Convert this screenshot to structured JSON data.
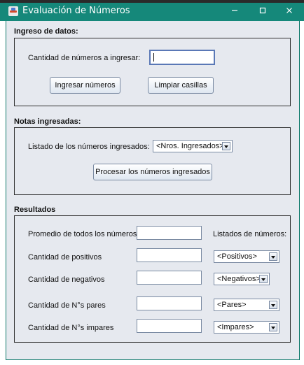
{
  "window": {
    "title": "Evaluación de Números",
    "controls": {
      "minimize": "—",
      "maximize": "☐",
      "close": "✕"
    }
  },
  "ingreso": {
    "title": "Ingreso de datos:",
    "cantidad_label": "Cantidad de números a ingresar:",
    "cantidad_value": "",
    "btn_ingresar": "Ingresar números",
    "btn_limpiar": "Limpiar casillas"
  },
  "notas": {
    "title": "Notas ingresadas:",
    "listado_label": "Listado de los números ingresados:",
    "listado_selected": "<Nros. Ingresados>",
    "btn_procesar": "Procesar los números ingresados"
  },
  "resultados": {
    "title": "Resultados",
    "listados_header": "Listados de números:",
    "rows": [
      {
        "label": "Promedio de todos los números",
        "value": "",
        "combo": null
      },
      {
        "label": "Cantidad de positivos",
        "value": "",
        "combo": "<Positivos>"
      },
      {
        "label": "Cantidad de negativos",
        "value": "",
        "combo": "<Negativos>"
      },
      {
        "label": "Cantidad de N°s pares",
        "value": "",
        "combo": "<Pares>"
      },
      {
        "label": "Cantidad de N°s impares",
        "value": "",
        "combo": "<Impares>"
      }
    ]
  },
  "icons": {
    "app": "java-app-icon",
    "minimize": "minimize-icon",
    "maximize": "maximize-icon",
    "close": "close-icon",
    "combo_arrow": "chevron-down-icon"
  },
  "colors": {
    "titlebar": "#15887a",
    "panel_bg": "#e6e9ef",
    "border": "#2d2d2d",
    "focus": "#5a78b6"
  }
}
